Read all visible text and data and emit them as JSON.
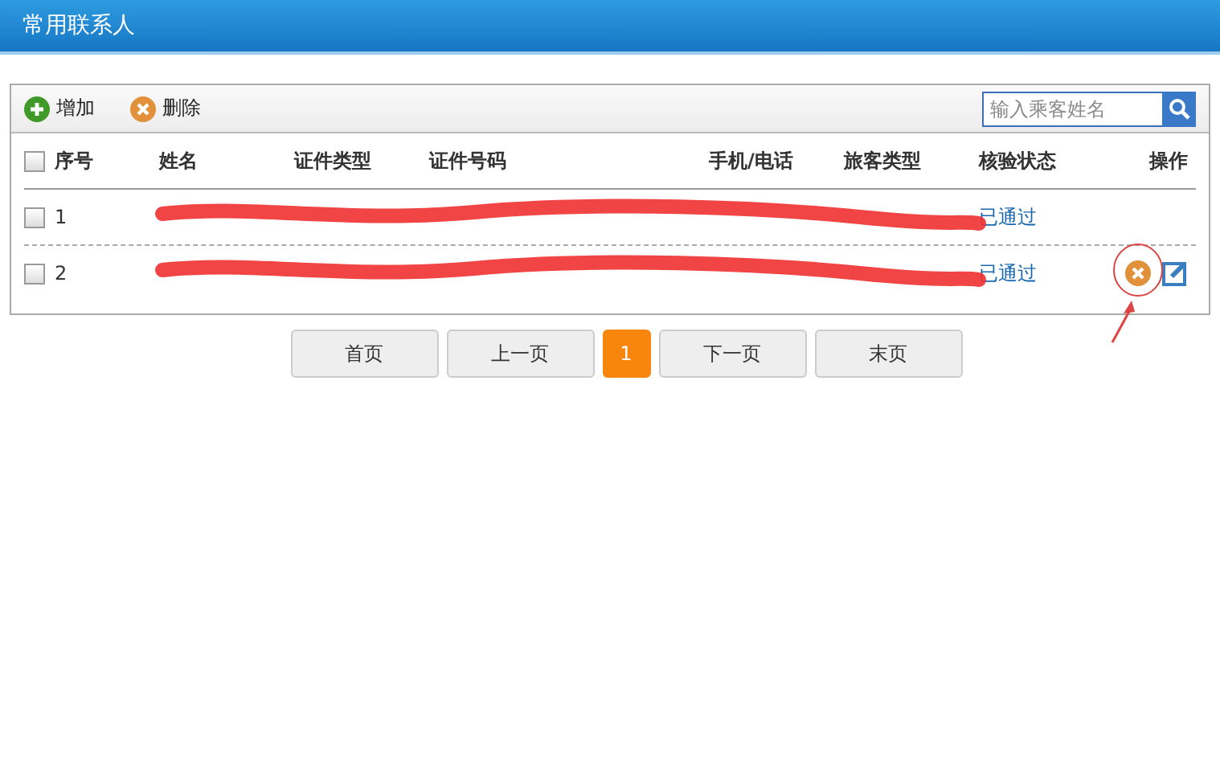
{
  "window": {
    "title": "常用联系人"
  },
  "toolbar": {
    "buttons": [
      {
        "label": "增加",
        "kind": "add"
      },
      {
        "label": "删除",
        "kind": "delete"
      }
    ],
    "search": {
      "placeholder": "输入乘客姓名"
    }
  },
  "table": {
    "select_all": {
      "checked": false
    },
    "columns": [
      "序号",
      "姓名",
      "证件类型",
      "证件号码",
      "手机/电话",
      "旅客类型",
      "核验状态",
      "操作"
    ],
    "rows": [
      {
        "checked": false,
        "index": "1",
        "status": "已通过",
        "redacted": true
      },
      {
        "checked": false,
        "index": "2",
        "status": "已通过",
        "actions": [
          {
            "kind": "delete"
          },
          {
            "kind": "edit"
          }
        ],
        "redacted": true
      }
    ]
  },
  "pagination": [
    {
      "label": "首页",
      "selected": false
    },
    {
      "label": "上一页",
      "selected": false
    },
    {
      "label": "1",
      "selected": true
    },
    {
      "label": "下一页",
      "selected": false
    },
    {
      "label": "末页",
      "selected": false
    }
  ]
}
